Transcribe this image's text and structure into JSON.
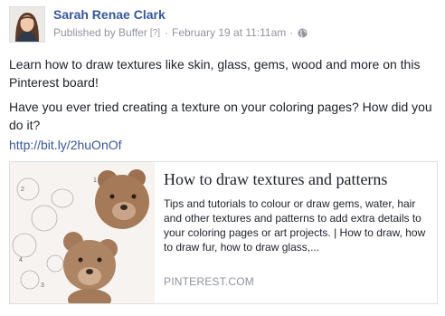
{
  "post": {
    "author": "Sarah Renae Clark",
    "published_by": "Published by Buffer",
    "help_marker": "[?]",
    "separator": "·",
    "date": "February 19 at 11:11am",
    "privacy_icon": "globe-icon",
    "paragraph1": "Learn how to draw textures like skin, glass, gems, wood and more on this Pinterest board!",
    "paragraph2": "Have you ever tried creating a texture on your coloring pages? How did you do it?",
    "link": "http://bit.ly/2huOnOf"
  },
  "card": {
    "title": "How to draw textures and patterns",
    "description": "Tips and tutorials to colour or draw gems, water, hair and other textures and patterns to add extra details to your coloring pages or art projects. | How to draw, how to draw fur, how to draw glass,...",
    "source": "PINTEREST.COM"
  },
  "colors": {
    "link": "#365899",
    "text": "#1d2129",
    "muted": "#90949c",
    "border": "#dddfe2"
  }
}
